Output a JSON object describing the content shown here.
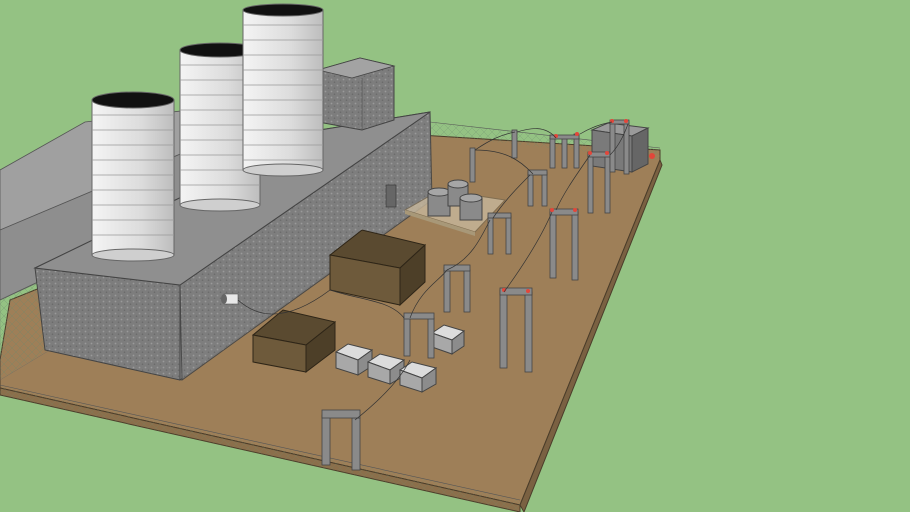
{
  "scene": {
    "background_color": "#94c283",
    "ground_color": "#9e7f58",
    "building_color": "#808080",
    "stack_color": "#e6e6e6",
    "box_dark_color": "#6e5a3b",
    "steel_color": "#8a8a8a",
    "insulator_color": "#e2463a"
  },
  "objects": {
    "stack_count": 3,
    "gantry_count": 11,
    "transformer_pad_count": 5,
    "tank_count": 3
  },
  "icons": {
    "cooling_stack": "cylinder",
    "gantry": "portal-frame",
    "transformer": "pyramid-box"
  }
}
